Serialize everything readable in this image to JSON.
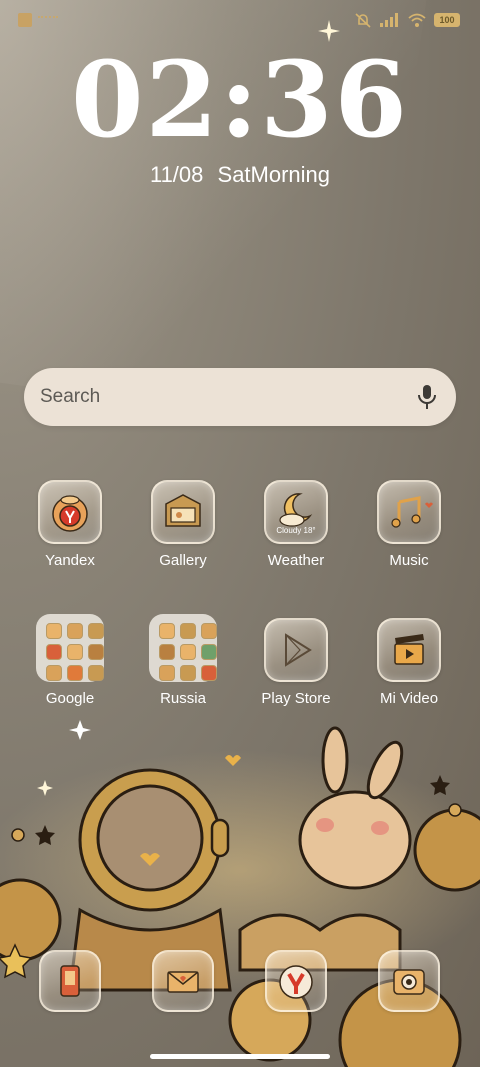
{
  "status_bar": {
    "battery": "100",
    "icons": [
      "notification-app-icon",
      "mute-icon",
      "signal-icon",
      "wifi-icon",
      "battery-icon"
    ]
  },
  "clock": {
    "time": "02:36"
  },
  "date": {
    "date": "11/08",
    "day_part": "SatMorning"
  },
  "search": {
    "placeholder": "Search",
    "mic_icon": "mic-icon"
  },
  "apps_row1": [
    {
      "label": "Yandex",
      "icon": "yandex-icon"
    },
    {
      "label": "Gallery",
      "icon": "gallery-icon"
    },
    {
      "label": "Weather",
      "icon": "weather-icon",
      "widget_text": "Cloudy 18°"
    },
    {
      "label": "Music",
      "icon": "music-icon"
    }
  ],
  "apps_row2": [
    {
      "label": "Google",
      "icon": "google-folder-icon"
    },
    {
      "label": "Russia",
      "icon": "russia-folder-icon"
    },
    {
      "label": "Play Store",
      "icon": "play-store-icon"
    },
    {
      "label": "Mi Video",
      "icon": "mi-video-icon"
    }
  ],
  "dock": [
    {
      "icon": "phone-icon"
    },
    {
      "icon": "messages-icon"
    },
    {
      "icon": "yandex-browser-icon"
    },
    {
      "icon": "camera-icon"
    }
  ],
  "colors": {
    "accent": "#d6b46e",
    "search_bg": "#ece2d6",
    "bg": "#857d70"
  }
}
